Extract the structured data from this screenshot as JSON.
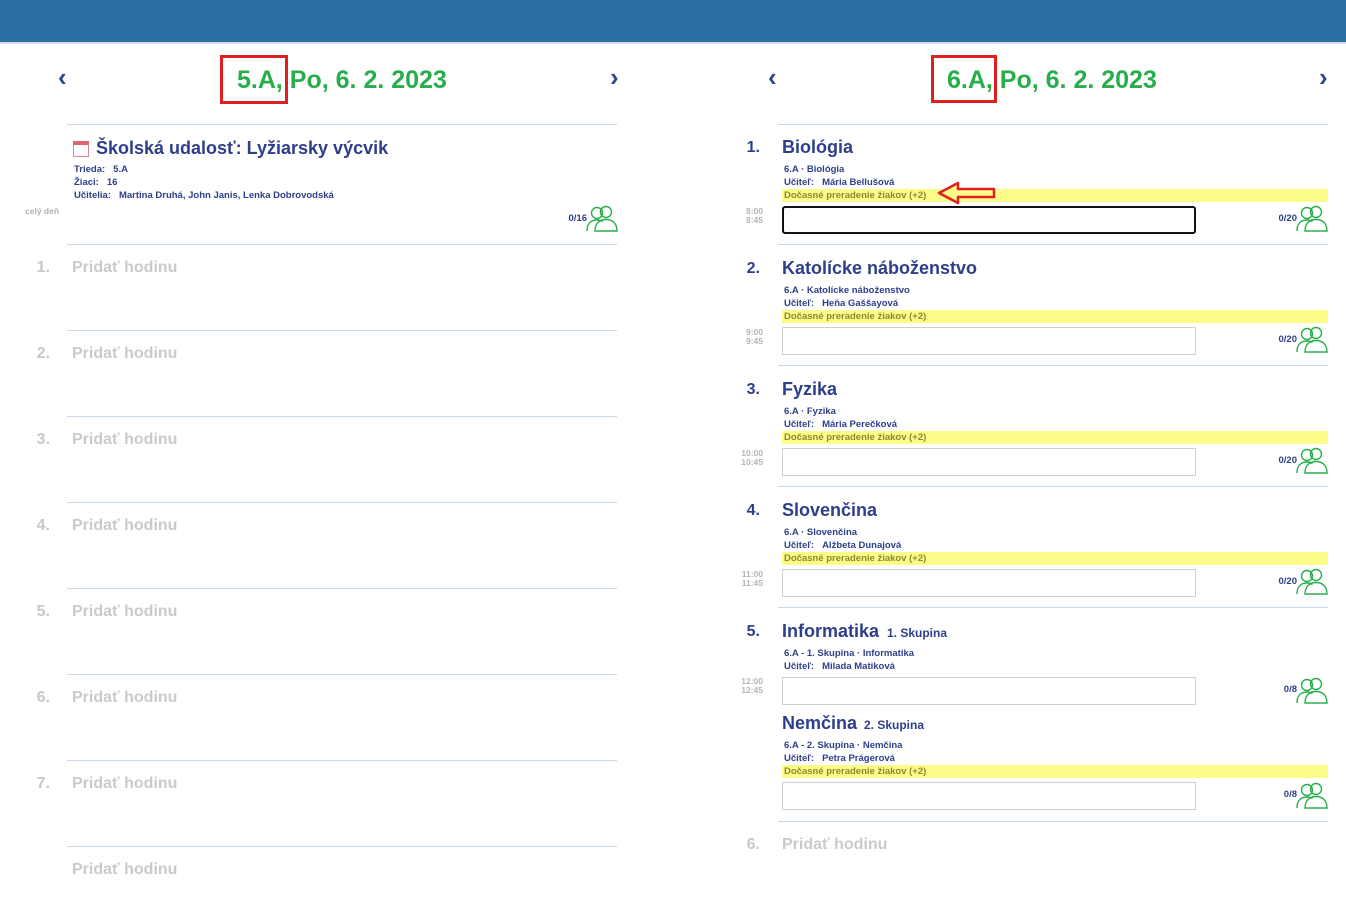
{
  "left": {
    "nav_prev": "‹",
    "nav_next": "›",
    "title_class": "5.A,",
    "title_date": " Po, 6. 2. 2023",
    "event": {
      "allday_label": "celý deň",
      "title": "Školská udalosť: Lyžiarsky výcvik",
      "class_key": "Trieda:",
      "class_val": "5.A",
      "students_key": "Žiaci:",
      "students_val": "16",
      "teachers_key": "Učitelia:",
      "teachers_val": "Martina Druhá, John Janis, Lenka Dobrovodská",
      "count": "0/16"
    },
    "add_label": "Pridať hodinu",
    "empty_slots": [
      "1.",
      "2.",
      "3.",
      "4.",
      "5.",
      "6.",
      "7.",
      ""
    ]
  },
  "right": {
    "nav_prev": "‹",
    "nav_next": "›",
    "title_class": "6.A,",
    "title_date": " Po, 6. 2. 2023",
    "teacher_key": "Učiteľ:",
    "highlight": "Dočasné preradenie žiakov (+2)",
    "lessons": [
      {
        "num": "1.",
        "subject": "Biológia",
        "group": "",
        "line1": "6.A · Biológia",
        "teacher": "Mária Bellušová",
        "start": "8:00",
        "end": "8:45",
        "count": "0/20"
      },
      {
        "num": "2.",
        "subject": "Katolícke náboženstvo",
        "group": "",
        "line1": "6.A · Katolícke náboženstvo",
        "teacher": "Heňa Gaššayová",
        "start": "9:00",
        "end": "9:45",
        "count": "0/20"
      },
      {
        "num": "3.",
        "subject": "Fyzika",
        "group": "",
        "line1": "6.A · Fyzika",
        "teacher": "Mária Perečková",
        "start": "10:00",
        "end": "10:45",
        "count": "0/20"
      },
      {
        "num": "4.",
        "subject": "Slovenčina",
        "group": "",
        "line1": "6.A · Slovenčina",
        "teacher": "Alžbeta Dunajová",
        "start": "11:00",
        "end": "11:45",
        "count": "0/20"
      },
      {
        "num": "5.",
        "subject": "Informatika",
        "group": "1. Skupina",
        "line1": "6.A - 1. Skupina · Informatika",
        "teacher": "Milada Matiková",
        "start": "12:00",
        "end": "12:45",
        "count": "0/8"
      },
      {
        "num": "",
        "subject": "Nemčina",
        "group": "2. Skupina",
        "line1": "6.A - 2. Skupina · Nemčina",
        "teacher": "Petra Prágerová",
        "start": "",
        "end": "",
        "count": "0/8"
      }
    ],
    "add_num": "6.",
    "add_label": "Pridať hodinu"
  },
  "colors": {
    "header_bar": "#2b6ea3",
    "title_green": "#27ae4b",
    "text_navy": "#2d3f8a",
    "highlight_yellow": "#fdfc88",
    "annotation_red": "#e02020",
    "people_icon_green": "#27ae4b"
  },
  "icons": [
    "calendar-icon",
    "people-icon",
    "chevron-left-icon",
    "chevron-right-icon",
    "annotation-arrow"
  ]
}
